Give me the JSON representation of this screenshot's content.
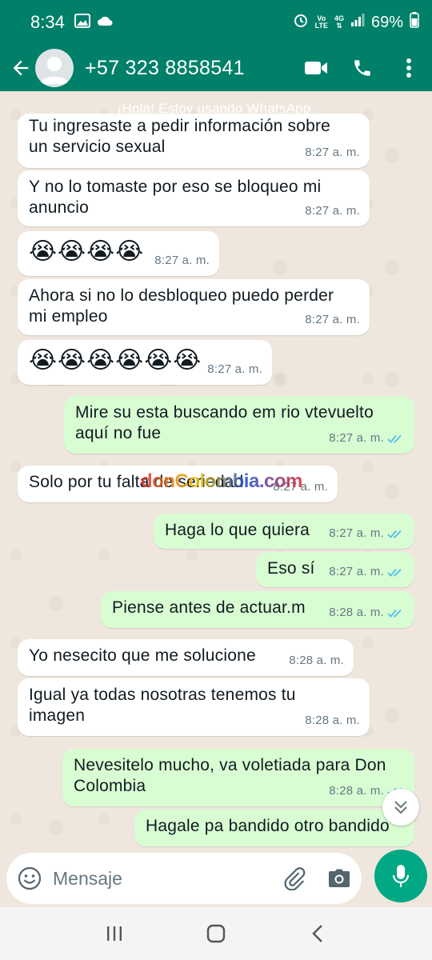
{
  "status_bar": {
    "time": "8:34",
    "net_top": "Vo",
    "net_bottom": "LTE",
    "net4g": "4G",
    "battery": "69%"
  },
  "header": {
    "contact": "+57 323 8858541",
    "icons": [
      "back-arrow-icon",
      "avatar",
      "video-call-icon",
      "phone-icon",
      "more-vert-icon"
    ]
  },
  "chat": {
    "info": "¡Hola! Estoy usando WhatsApp.",
    "watermark": "donColombia.com",
    "messages": [
      {
        "dir": "in",
        "text": "Tu ingresaste a pedir información sobre\nun servicio sexual",
        "time": "8:27 a. m."
      },
      {
        "dir": "in",
        "text": "Y no lo tomaste por eso se bloqueo mi\nanuncio",
        "time": "8:27 a. m."
      },
      {
        "dir": "in",
        "text": "😭😭😭😭",
        "time": "8:27 a. m."
      },
      {
        "dir": "in",
        "text": "Ahora si no lo desbloqueo puedo perder\nmi empleo",
        "time": "8:27 a. m."
      },
      {
        "dir": "in",
        "text": "😭😭😭😭😭😭",
        "time": "8:27 a. m."
      },
      {
        "dir": "out",
        "text": "Mire su esta buscando em rio vtevuelto\naquí no fue",
        "time": "8:27 a. m."
      },
      {
        "dir": "in",
        "text": "Solo por tu falta de seriedad",
        "time": "8:27 a. m."
      },
      {
        "dir": "out",
        "text": "Haga lo que quiera",
        "time": "8:27 a. m."
      },
      {
        "dir": "out",
        "text": "Eso sí",
        "time": "8:27 a. m."
      },
      {
        "dir": "out",
        "text": "Piense antes de actuar.m",
        "time": "8:28 a. m."
      },
      {
        "dir": "in",
        "text": "Yo nesecito que me solucione",
        "time": "8:28 a. m."
      },
      {
        "dir": "in",
        "text": "Igual ya todas nosotras tenemos tu\nimagen",
        "time": "8:28 a. m."
      },
      {
        "dir": "out",
        "text": "Nevesitelo mucho, va voletiada para Don\nColombia",
        "time": "8:28 a. m."
      },
      {
        "dir": "out",
        "text": "Hagale pa bandido otro bandido",
        "time": ""
      }
    ]
  },
  "composer": {
    "placeholder": "Mensaje"
  },
  "colors": {
    "header": "#008069",
    "incoming": "#ffffff",
    "outgoing": "#d9fdd3",
    "read_ticks": "#53bdeb",
    "mic": "#00a884"
  }
}
